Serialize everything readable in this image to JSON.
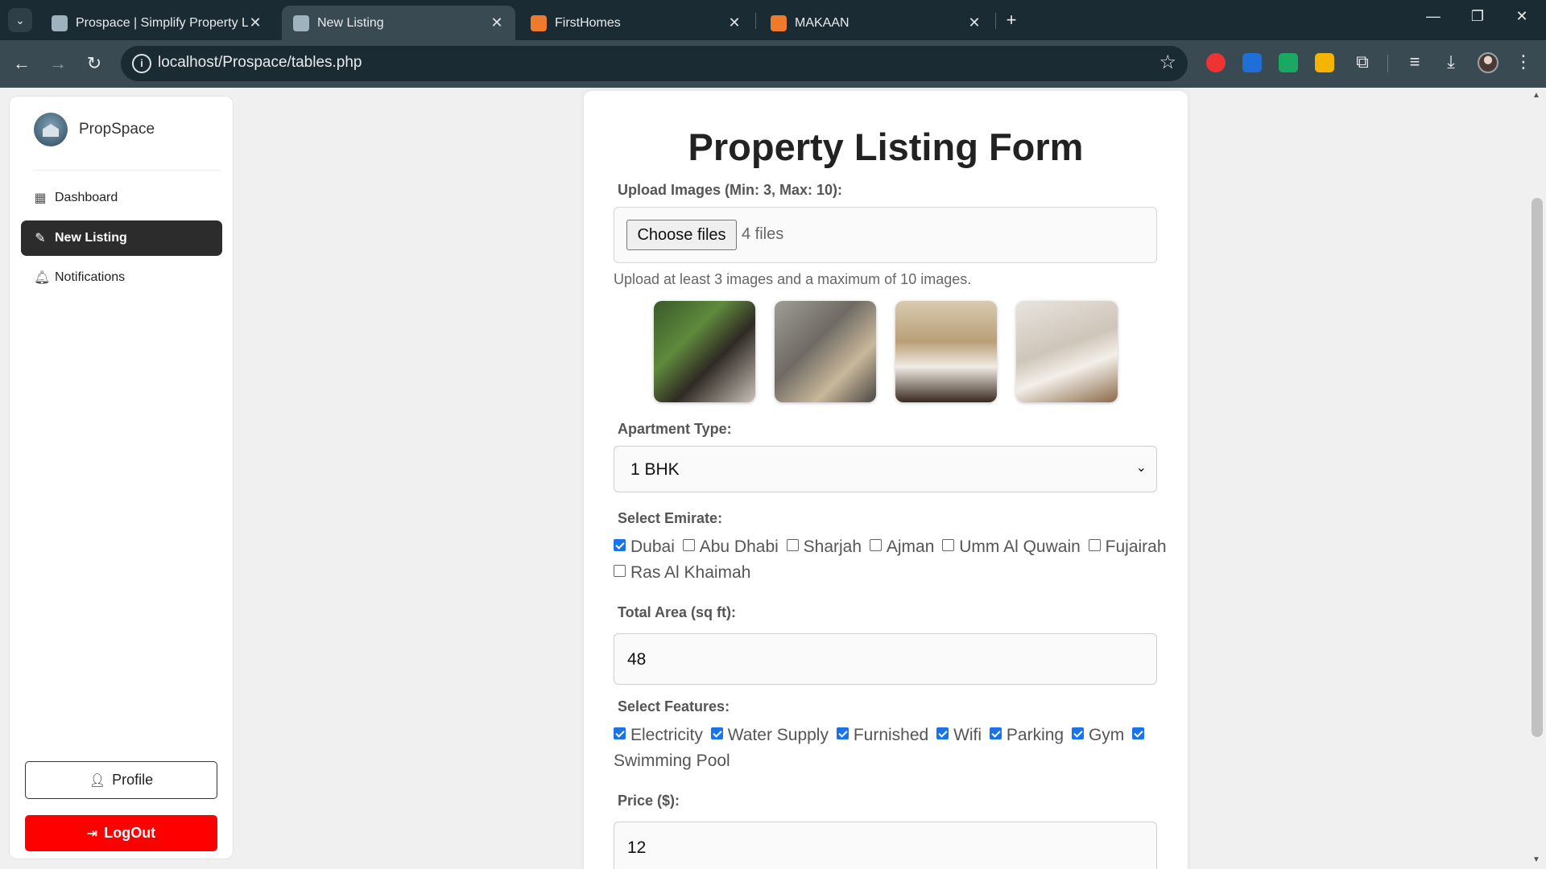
{
  "browser": {
    "tabs": [
      {
        "title": "Prospace | Simplify Property Lis",
        "active": false
      },
      {
        "title": "New Listing",
        "active": true
      },
      {
        "title": "FirstHomes",
        "active": false
      },
      {
        "title": "MAKAAN",
        "active": false
      }
    ],
    "url": "localhost/Prospace/tables.php"
  },
  "sidebar": {
    "brand": "PropSpace",
    "items": [
      {
        "label": "Dashboard",
        "icon": "grid-icon",
        "active": false
      },
      {
        "label": "New Listing",
        "icon": "pencil-icon",
        "active": true
      },
      {
        "label": "Notifications",
        "icon": "bell-icon",
        "active": false
      }
    ],
    "profile_label": "Profile",
    "logout_label": "LogOut"
  },
  "form": {
    "title": "Property Listing Form",
    "upload": {
      "label": "Upload Images (Min: 3, Max: 10):",
      "button": "Choose files",
      "count": "4 files",
      "help": "Upload at least 3 images and a maximum of 10 images.",
      "previews": [
        "balcony-photo",
        "bathroom-photo",
        "bedroom-photo",
        "living-room-photo"
      ]
    },
    "apartment_type": {
      "label": "Apartment Type:",
      "value": "1 BHK"
    },
    "emirate": {
      "label": "Select Emirate:",
      "options": [
        {
          "label": "Dubai",
          "checked": true
        },
        {
          "label": "Abu Dhabi",
          "checked": false
        },
        {
          "label": "Sharjah",
          "checked": false
        },
        {
          "label": "Ajman",
          "checked": false
        },
        {
          "label": "Umm Al Quwain",
          "checked": false
        },
        {
          "label": "Fujairah",
          "checked": false
        },
        {
          "label": "Ras Al Khaimah",
          "checked": false
        }
      ]
    },
    "area": {
      "label": "Total Area (sq ft):",
      "value": "48"
    },
    "features": {
      "label": "Select Features:",
      "options": [
        {
          "label": "Electricity",
          "checked": true
        },
        {
          "label": "Water Supply",
          "checked": true
        },
        {
          "label": "Furnished",
          "checked": true
        },
        {
          "label": "Wifi",
          "checked": true
        },
        {
          "label": "Parking",
          "checked": true
        },
        {
          "label": "Gym",
          "checked": true
        },
        {
          "label": "Swimming Pool",
          "checked": true
        }
      ]
    },
    "price": {
      "label": "Price ($):",
      "value": "12"
    }
  },
  "colors": {
    "accent": "#1a73e8",
    "logout": "#ff0000",
    "active_nav": "#2c2c2c",
    "chrome_dark": "#1b2b33",
    "chrome_toolbar": "#3a4a52"
  }
}
